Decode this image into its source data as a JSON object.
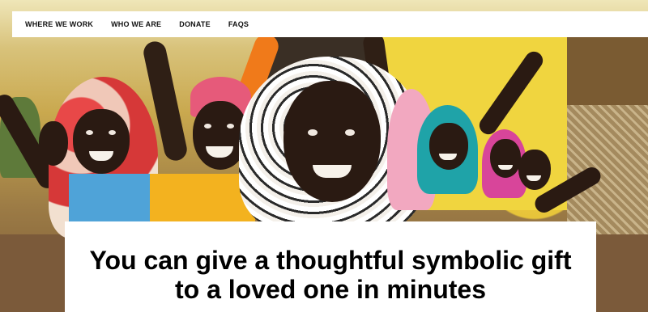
{
  "nav": {
    "items": [
      {
        "label": "WHERE WE WORK"
      },
      {
        "label": "WHO WE ARE"
      },
      {
        "label": "DONATE"
      },
      {
        "label": "FAQS"
      }
    ]
  },
  "hero": {
    "image_description_icon": "photo-of-smiling-children",
    "headline_line1": "You can give a thoughtful symbolic gift",
    "headline_line2": "to a loved one in minutes"
  },
  "colors": {
    "nav_bg": "#ffffff",
    "nav_text": "#111111",
    "card_bg": "#ffffff",
    "headline_text": "#000000"
  }
}
